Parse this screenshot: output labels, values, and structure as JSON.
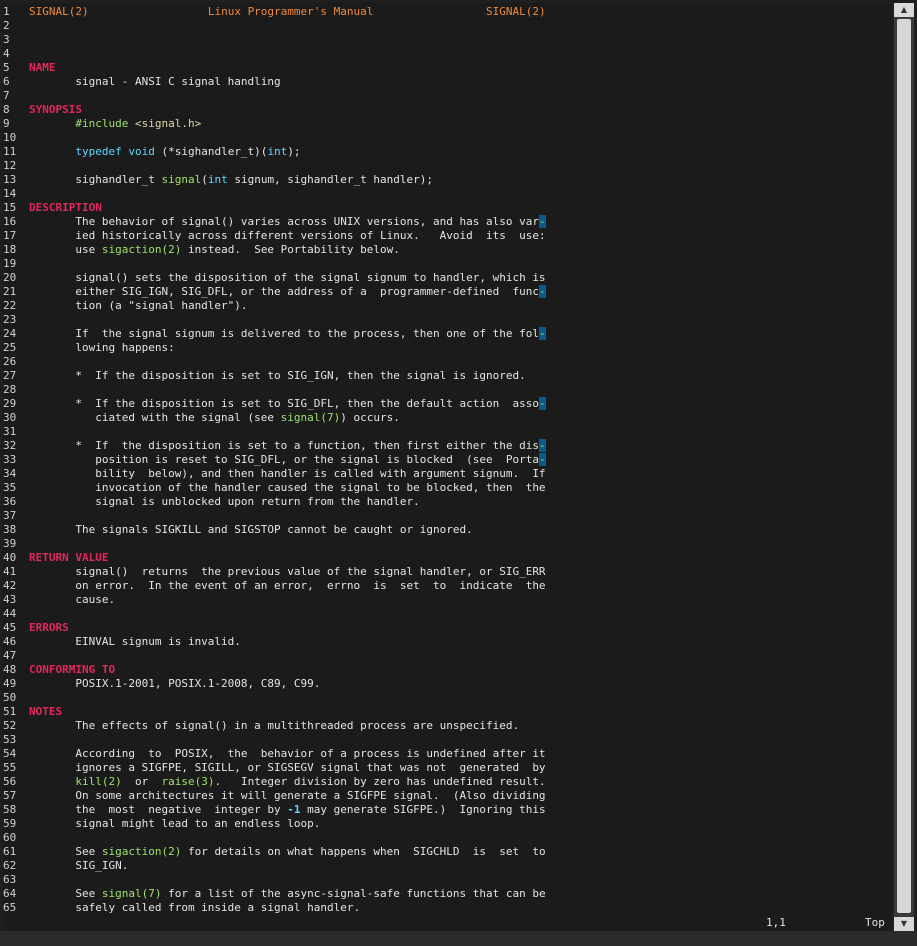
{
  "header": {
    "left": "SIGNAL(2)",
    "center": "Linux Programmer's Manual",
    "right": "SIGNAL(2)"
  },
  "lines": [
    [
      [
        "header",
        "SIGNAL(2)"
      ],
      [
        "plain",
        "                  "
      ],
      [
        "header",
        "Linux Programmer's Manual"
      ],
      [
        "plain",
        "                 "
      ],
      [
        "header",
        "SIGNAL(2)"
      ]
    ],
    [],
    [],
    [],
    [
      [
        "section",
        "NAME"
      ]
    ],
    [
      [
        "plain",
        "       signal - ANSI C signal handling"
      ]
    ],
    [],
    [
      [
        "section",
        "SYNOPSIS"
      ]
    ],
    [
      [
        "plain",
        "       "
      ],
      [
        "pre",
        "#include"
      ],
      [
        "plain",
        " "
      ],
      [
        "str",
        "<signal.h>"
      ]
    ],
    [],
    [
      [
        "plain",
        "       "
      ],
      [
        "type",
        "typedef"
      ],
      [
        "plain",
        " "
      ],
      [
        "type",
        "void"
      ],
      [
        "plain",
        " (*sighandler_t)("
      ],
      [
        "type",
        "int"
      ],
      [
        "plain",
        ");"
      ]
    ],
    [],
    [
      [
        "plain",
        "       sighandler_t "
      ],
      [
        "fn",
        "signal"
      ],
      [
        "plain",
        "("
      ],
      [
        "type",
        "int"
      ],
      [
        "plain",
        " signum, sighandler_t handler);"
      ]
    ],
    [],
    [
      [
        "section",
        "DESCRIPTION"
      ]
    ],
    [
      [
        "plain",
        "       The behavior of signal() varies across UNIX versions, and has also var"
      ],
      [
        "hyph",
        "-"
      ]
    ],
    [
      [
        "plain",
        "       ied historically across different versions of Linux.   Avoid  its  use:"
      ]
    ],
    [
      [
        "plain",
        "       use "
      ],
      [
        "ref",
        "sigaction(2)"
      ],
      [
        "plain",
        " instead.  See Portability below."
      ]
    ],
    [],
    [
      [
        "plain",
        "       signal() sets the disposition of the signal signum to handler, which is"
      ]
    ],
    [
      [
        "plain",
        "       either SIG_IGN, SIG_DFL, or the address of a  programmer-defined  func"
      ],
      [
        "hyph",
        "-"
      ]
    ],
    [
      [
        "plain",
        "       tion (a \"signal handler\")."
      ]
    ],
    [],
    [
      [
        "plain",
        "       If  the signal signum is delivered to the process, then one of the fol"
      ],
      [
        "hyph",
        "-"
      ]
    ],
    [
      [
        "plain",
        "       lowing happens:"
      ]
    ],
    [],
    [
      [
        "plain",
        "       *  If the disposition is set to SIG_IGN, then the signal is ignored."
      ]
    ],
    [],
    [
      [
        "plain",
        "       *  If the disposition is set to SIG_DFL, then the default action  asso"
      ],
      [
        "hyph",
        "-"
      ]
    ],
    [
      [
        "plain",
        "          ciated with the signal (see "
      ],
      [
        "ref",
        "signal(7)"
      ],
      [
        "plain",
        ") occurs."
      ]
    ],
    [],
    [
      [
        "plain",
        "       *  If  the disposition is set to a function, then first either the dis"
      ],
      [
        "hyph",
        "-"
      ]
    ],
    [
      [
        "plain",
        "          position is reset to SIG_DFL, or the signal is blocked  (see  Porta"
      ],
      [
        "hyph",
        "-"
      ]
    ],
    [
      [
        "plain",
        "          bility  below), and then handler is called with argument signum.  If"
      ]
    ],
    [
      [
        "plain",
        "          invocation of the handler caused the signal to be blocked, then  the"
      ]
    ],
    [
      [
        "plain",
        "          signal is unblocked upon return from the handler."
      ]
    ],
    [],
    [
      [
        "plain",
        "       The signals SIGKILL and SIGSTOP cannot be caught or ignored."
      ]
    ],
    [],
    [
      [
        "section",
        "RETURN VALUE"
      ]
    ],
    [
      [
        "plain",
        "       signal()  returns  the previous value of the signal handler, or SIG_ERR"
      ]
    ],
    [
      [
        "plain",
        "       on error.  In the event of an error,  errno  is  set  to  indicate  the"
      ]
    ],
    [
      [
        "plain",
        "       cause."
      ]
    ],
    [],
    [
      [
        "section",
        "ERRORS"
      ]
    ],
    [
      [
        "plain",
        "       EINVAL signum is invalid."
      ]
    ],
    [],
    [
      [
        "section",
        "CONFORMING TO"
      ]
    ],
    [
      [
        "plain",
        "       POSIX.1-2001, POSIX.1-2008, C89, C99."
      ]
    ],
    [],
    [
      [
        "section",
        "NOTES"
      ]
    ],
    [
      [
        "plain",
        "       The effects of signal() in a multithreaded process are unspecified."
      ]
    ],
    [],
    [
      [
        "plain",
        "       According  to  POSIX,  the  behavior of a process is undefined after it"
      ]
    ],
    [
      [
        "plain",
        "       ignores a SIGFPE, SIGILL, or SIGSEGV signal that was not  generated  by"
      ]
    ],
    [
      [
        "plain",
        "       "
      ],
      [
        "ref",
        "kill(2)"
      ],
      [
        "plain",
        "  or  "
      ],
      [
        "ref",
        "raise(3)"
      ],
      [
        "plain",
        ".   Integer division by zero has undefined result."
      ]
    ],
    [
      [
        "plain",
        "       On some architectures it will generate a SIGFPE signal.  (Also dividing"
      ]
    ],
    [
      [
        "plain",
        "       the  most  negative  integer by "
      ],
      [
        "num",
        "-1"
      ],
      [
        "plain",
        " may generate SIGFPE.)  Ignoring this"
      ]
    ],
    [
      [
        "plain",
        "       signal might lead to an endless loop."
      ]
    ],
    [],
    [
      [
        "plain",
        "       See "
      ],
      [
        "ref",
        "sigaction(2)"
      ],
      [
        "plain",
        " for details on what happens when  SIGCHLD  is  set  to"
      ]
    ],
    [
      [
        "plain",
        "       SIG_IGN."
      ]
    ],
    [],
    [
      [
        "plain",
        "       See "
      ],
      [
        "ref",
        "signal(7)"
      ],
      [
        "plain",
        " for a list of the async-signal-safe functions that can be"
      ]
    ],
    [
      [
        "plain",
        "       safely called from inside a signal handler."
      ]
    ]
  ],
  "status": {
    "position": "1,1",
    "scroll": "Top"
  },
  "colors": {
    "background": "#1b1b1b",
    "text": "#e4e4e4",
    "header": "#f08a3a",
    "section": "#e0285a",
    "preprocessor": "#9ee36a",
    "string": "#e0d7a8",
    "type": "#5fd7ff",
    "reference": "#9ee36a",
    "hyphen_highlight": "#0a5a8a"
  },
  "scrollbar": {
    "up_icon": "arrow-up-icon",
    "down_icon": "arrow-down-icon",
    "position": 0.0
  }
}
